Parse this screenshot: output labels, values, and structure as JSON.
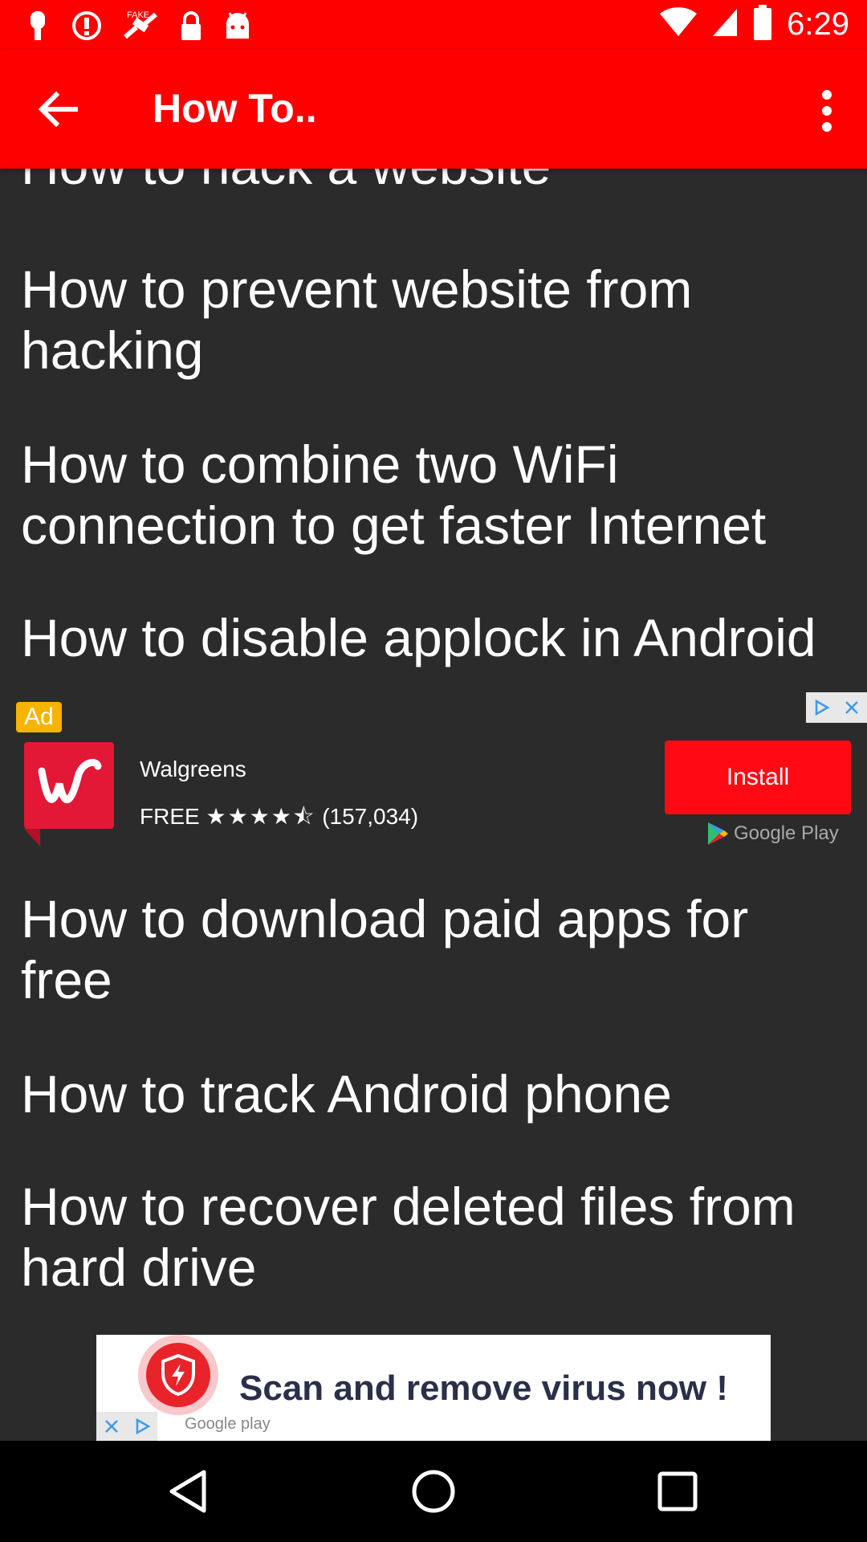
{
  "status_bar": {
    "time": "6:29",
    "icons": [
      "notification-icon",
      "alert-icon",
      "fake-gps-icon",
      "lock-icon",
      "android-icon",
      "wifi-icon",
      "cellular-icon",
      "battery-icon"
    ]
  },
  "app_bar": {
    "title": "How To..",
    "back_icon": "arrow-back-icon",
    "menu_icon": "more-vert-icon",
    "color": "#ff0000"
  },
  "list": {
    "items_before_ad": [
      "How to hack a website",
      "How to prevent website from hacking",
      "How to combine two WiFi connection to get faster Internet",
      "How to disable applock in Android"
    ],
    "items_after_ad": [
      "How to download paid apps for free",
      "How to track Android phone",
      "How to recover deleted files from hard drive"
    ]
  },
  "native_ad": {
    "badge": "Ad",
    "app_name": "Walgreens",
    "price": "FREE",
    "stars": "★★★★⯪",
    "rating": 4.5,
    "reviews": "(157,034)",
    "install_label": "Install",
    "store": "Google Play"
  },
  "banner_ad": {
    "text": "Scan and remove virus now !",
    "store": "Google play"
  },
  "nav_bar": {
    "icons": [
      "back-triangle-icon",
      "home-circle-icon",
      "recents-square-icon"
    ]
  }
}
